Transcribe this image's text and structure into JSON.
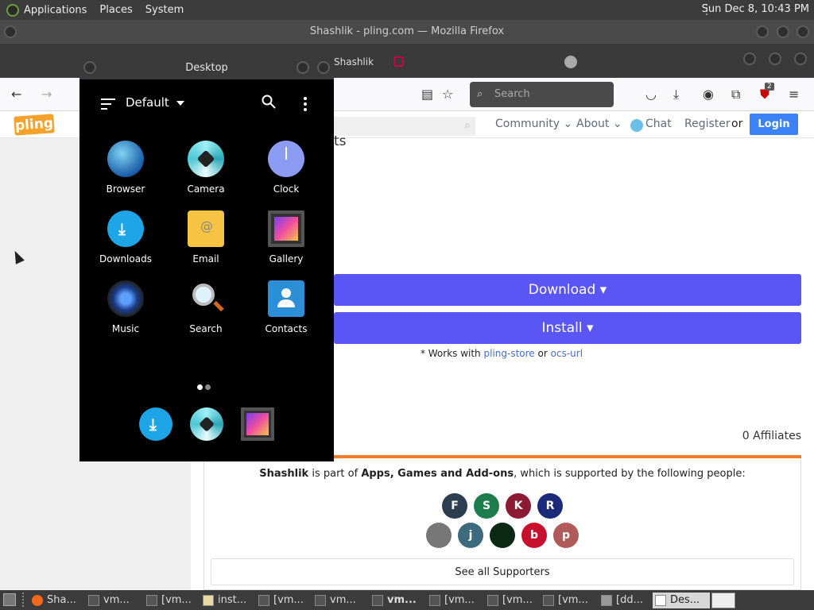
{
  "top_panel": {
    "menus": [
      "Applications",
      "Places",
      "System"
    ],
    "clock": "Sun Dec  8, 10:43 PM"
  },
  "firefox": {
    "title": "Shashlik - pling.com — Mozilla Firefox",
    "active_tab_label": "Shashlik",
    "search_placeholder": "Search",
    "extension_badge": "2"
  },
  "site": {
    "logo": "pling",
    "nav": [
      "Community",
      "About",
      "Chat",
      "Register",
      "or"
    ],
    "login": "Login",
    "partial_heading": "ts",
    "download_label": "Download",
    "install_label": "Install",
    "works_prefix": "* Works with",
    "works_link1": "pling-store",
    "works_or": "or",
    "works_link2": "ocs-url",
    "affiliates": "0 Affiliates",
    "support_name": "Shashlik",
    "support_mid": "is part of",
    "support_category": "Apps, Games and Add-ons",
    "support_suffix": ", which is supported by the following people:",
    "supporters": [
      {
        "initial": "F",
        "color": "#2c3e50"
      },
      {
        "initial": "S",
        "color": "#1e7d4c"
      },
      {
        "initial": "K",
        "color": "#8b1a32"
      },
      {
        "initial": "R",
        "color": "#1c2a7a"
      },
      {
        "initial": "",
        "color": "#777777"
      },
      {
        "initial": "j",
        "color": "#3d6a7c"
      },
      {
        "initial": "",
        "color": "#0b2a14"
      },
      {
        "initial": "b",
        "color": "#c8102e"
      },
      {
        "initial": "p",
        "color": "#b05a5a"
      }
    ],
    "see_all": "See all Supporters"
  },
  "desktop_window": {
    "title": "Desktop",
    "profile": "Default",
    "apps": [
      {
        "label": "Browser",
        "icon": "globe-icon"
      },
      {
        "label": "Camera",
        "icon": "camera-icon"
      },
      {
        "label": "Clock",
        "icon": "clock-icon"
      },
      {
        "label": "Downloads",
        "icon": "download-icon"
      },
      {
        "label": "Email",
        "icon": "email-icon"
      },
      {
        "label": "Gallery",
        "icon": "gallery-icon"
      },
      {
        "label": "Music",
        "icon": "music-icon"
      },
      {
        "label": "Search",
        "icon": "search-icon"
      },
      {
        "label": "Contacts",
        "icon": "contacts-icon"
      }
    ]
  },
  "taskbar": {
    "tasks": [
      "Sha...",
      "vm...",
      "[vm...",
      "inst...",
      "[vm...",
      "vm...",
      "vm...",
      "[vm...",
      "[vm...",
      "[vm...",
      "[dd...",
      "Des..."
    ]
  }
}
